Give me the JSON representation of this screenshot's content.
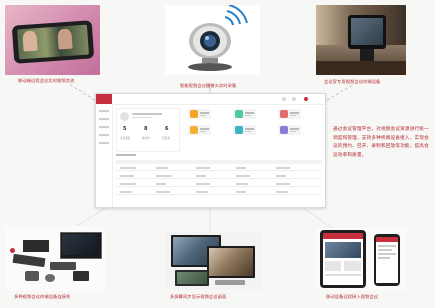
{
  "captions": {
    "top_left": "移动端远程会议实时视频交流",
    "top_center": "智能视频会议摄像头实时采集",
    "top_right": "会议室专用视频会议终端设备",
    "bottom_left": "多种视频会议终端设备连接到",
    "bottom_center": "多屏幕同步显示视频会议画面",
    "bottom_right": "移动设备远程接入视频会议"
  },
  "description": "通过会议管理平台，对视频会议资源进行统一调度和管理，支持多种终端设备接入，实现会议的预约、召开、录制和回放等功能，提高会议效率和质量。",
  "dashboard": {
    "logo_text": "视频会议",
    "user_greeting": "欢迎使用会议管理平台",
    "user_sub": "管理员账户",
    "stats": [
      {
        "value": "5",
        "label": "今日会议"
      },
      {
        "value": "8",
        "label": "进行中"
      },
      {
        "value": "6",
        "label": "已结束"
      }
    ],
    "tiles": [
      {
        "label": "预约会议",
        "color": "#f5a623"
      },
      {
        "label": "会议室",
        "color": "#4ec9a8"
      },
      {
        "label": "终端管理",
        "color": "#e46b6b"
      },
      {
        "label": "录制回放",
        "color": "#f2b134"
      },
      {
        "label": "通讯录",
        "color": "#3bb6c9"
      },
      {
        "label": "统计报表",
        "color": "#8e7bd9"
      }
    ],
    "section_title": "会议列表"
  },
  "colors": {
    "accent": "#c62f3b",
    "caption": "#b3262f"
  }
}
